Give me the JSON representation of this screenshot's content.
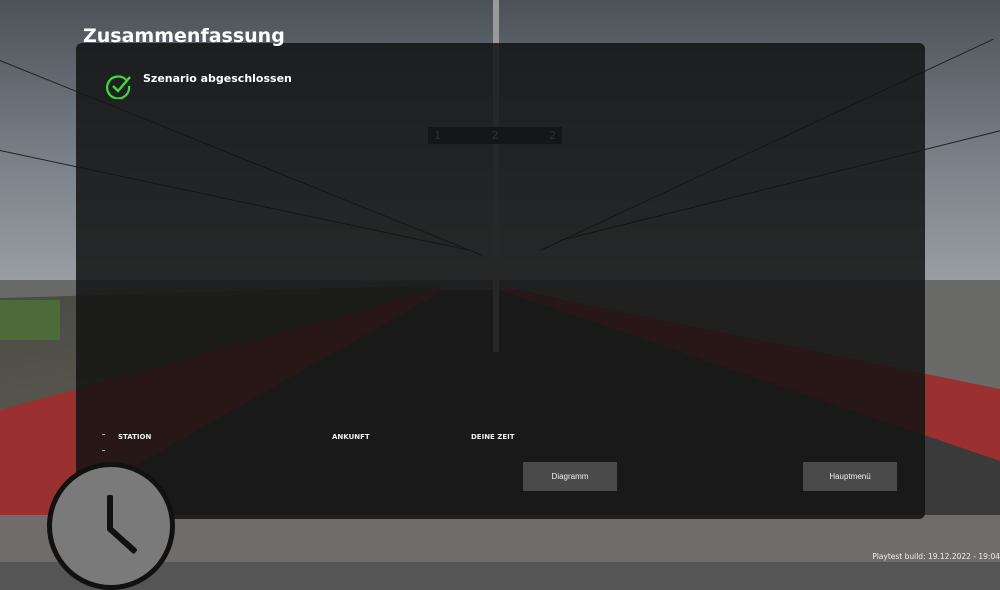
{
  "summary": {
    "title": "Zusammenfassung",
    "status": "Szenario abgeschlossen",
    "status_icon": "check-circle-icon",
    "status_color": "#3cdc3c"
  },
  "table": {
    "headers": [
      "STATION",
      "ANKUNFT",
      "DEINE ZEIT"
    ]
  },
  "buttons": {
    "diagram": "Diagramm",
    "main_menu": "Hauptmenü"
  },
  "scene_sign": {
    "left": "1",
    "center": "2",
    "right": "2"
  },
  "footer": {
    "build": "Playtest build: 19.12.2022 - 19:04"
  }
}
